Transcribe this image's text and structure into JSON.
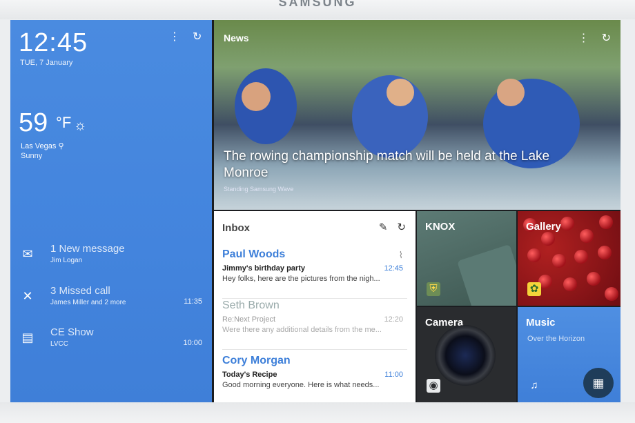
{
  "device": {
    "brand": "SAMSUNG"
  },
  "left_panel": {
    "time": "12:45",
    "date": "TUE, 7 January",
    "weather": {
      "temp": "59",
      "unit": "F",
      "location": "Las Vegas",
      "condition": "Sunny"
    },
    "icons": [
      "more-vert-icon",
      "refresh-icon"
    ],
    "notifications": [
      {
        "icon": "mail-icon",
        "title": "1 New message",
        "subtitle": "Jim Logan",
        "time": ""
      },
      {
        "icon": "missed-call-icon",
        "title": "3 Missed call",
        "subtitle": "James Miller and 2 more",
        "time": "11:35"
      },
      {
        "icon": "calendar-icon",
        "title": "CE Show",
        "subtitle": "LVCC",
        "time": "10:00"
      }
    ]
  },
  "news": {
    "label": "News",
    "headline": "The rowing championship match will be held at the Lake Monroe",
    "source": "Standing Samsung Wave"
  },
  "inbox": {
    "title": "Inbox",
    "items": [
      {
        "from": "Paul Woods",
        "subject": "Jimmy's birthday party",
        "preview": "Hey folks, here are the pictures from the nigh...",
        "time": "12:45",
        "attachment": true,
        "read": false
      },
      {
        "from": "Seth Brown",
        "subject": "Re:Next Project",
        "preview": "Were there any additional details from the me...",
        "time": "12:20",
        "attachment": false,
        "read": true
      },
      {
        "from": "Cory Morgan",
        "subject": "Today's Recipe",
        "preview": "Good morning everyone. Here is what needs...",
        "time": "11:00",
        "attachment": false,
        "read": false
      }
    ]
  },
  "tiles": {
    "knox": {
      "label": "KNOX"
    },
    "gallery": {
      "label": "Gallery"
    },
    "camera": {
      "label": "Camera"
    },
    "music": {
      "label": "Music",
      "subtitle": "Over the Horizon"
    }
  },
  "colors": {
    "accent": "#4384dd",
    "link": "#3d7fd9"
  }
}
